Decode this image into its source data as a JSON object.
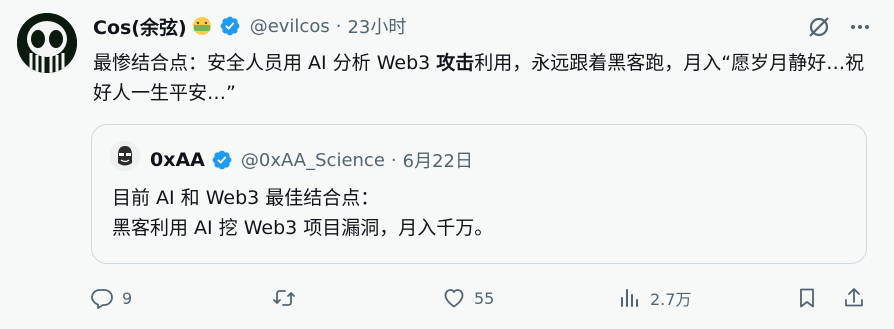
{
  "author": {
    "name": "Cos(余弦)",
    "handle": "@evilcos",
    "separator": "·",
    "time": "23小时"
  },
  "tweet": {
    "text_before": "最惨结合点：安全人员用 AI 分析 Web3 ",
    "text_bold": "攻击",
    "text_after": "利用，永远跟着黑客跑，月入“愿岁月静好…祝好人一生平安…”"
  },
  "quote": {
    "author_name": "0xAA",
    "handle": "@0xAA_Science",
    "separator": "·",
    "time": "6月22日",
    "lines": [
      "目前 AI 和 Web3 最佳结合点：",
      "黑客利用 AI 挖 Web3 项目漏洞，月入千万。"
    ]
  },
  "actions": {
    "replies": "9",
    "retweets": "",
    "likes": "55",
    "views": "2.7万"
  },
  "icons": {
    "verified": "verified-badge-icon",
    "emoji": "money-mouth-emoji",
    "grok": "grok-icon",
    "more": "more-icon",
    "reply": "reply-icon",
    "retweet": "retweet-icon",
    "like": "heart-icon",
    "views": "views-icon",
    "bookmark": "bookmark-icon",
    "share": "share-icon"
  },
  "colors": {
    "verified_blue": "#1d9bf0",
    "muted_text": "#536471",
    "border": "#cfd9de",
    "background": "#f7f9f9"
  }
}
